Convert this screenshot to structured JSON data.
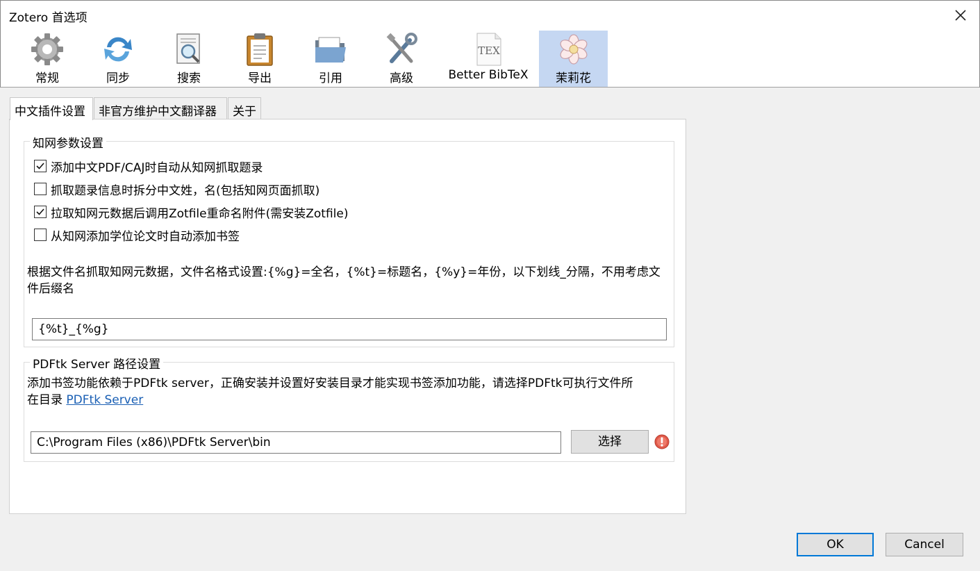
{
  "window": {
    "title": "Zotero 首选项"
  },
  "toolbar": {
    "items": [
      {
        "label": "常规",
        "icon": "gear-icon"
      },
      {
        "label": "同步",
        "icon": "sync-icon"
      },
      {
        "label": "搜索",
        "icon": "search-icon"
      },
      {
        "label": "导出",
        "icon": "clipboard-icon"
      },
      {
        "label": "引用",
        "icon": "folder-icon"
      },
      {
        "label": "高级",
        "icon": "tools-icon"
      },
      {
        "label": "Better BibTeX",
        "icon": "tex-icon"
      },
      {
        "label": "茉莉花",
        "icon": "jasmine-flower-icon"
      }
    ],
    "active": "茉莉花"
  },
  "tabs": [
    {
      "label": "中文插件设置",
      "active": true
    },
    {
      "label": "非官方维护中文翻译器",
      "active": false
    },
    {
      "label": "关于",
      "active": false
    }
  ],
  "cnki_group": {
    "legend": "知网参数设置",
    "checkboxes": [
      {
        "label": "添加中文PDF/CAJ时自动从知网抓取题录",
        "checked": true
      },
      {
        "label": "抓取题录信息时拆分中文姓，名(包括知网页面抓取)",
        "checked": false
      },
      {
        "label": "拉取知网元数据后调用Zotfile重命名附件(需安装Zotfile)",
        "checked": true
      },
      {
        "label": "从知网添加学位论文时自动添加书签",
        "checked": false
      }
    ],
    "filename_desc_line1": "根据文件名抓取知网元数据，文件名格式设置:{%g}=全名，{%t}=标题名，{%y}=年份，以下划线_分隔，不用考虑文",
    "filename_desc_line2": "件后缀名",
    "filename_format_value": "{%t}_{%g}"
  },
  "pdftk_group": {
    "legend": "PDFtk Server 路径设置",
    "desc_line1": "添加书签功能依赖于PDFtk server，正确安装并设置好安装目录才能实现书签添加功能，请选择PDFtk可执行文件所",
    "desc_line2_prefix": "在目录 ",
    "link_text": "PDFtk Server",
    "path_value": "C:\\Program Files (x86)\\PDFtk Server\\bin",
    "choose_label": "选择",
    "status_icon": "error-icon"
  },
  "footer": {
    "ok_label": "OK",
    "cancel_label": "Cancel"
  }
}
